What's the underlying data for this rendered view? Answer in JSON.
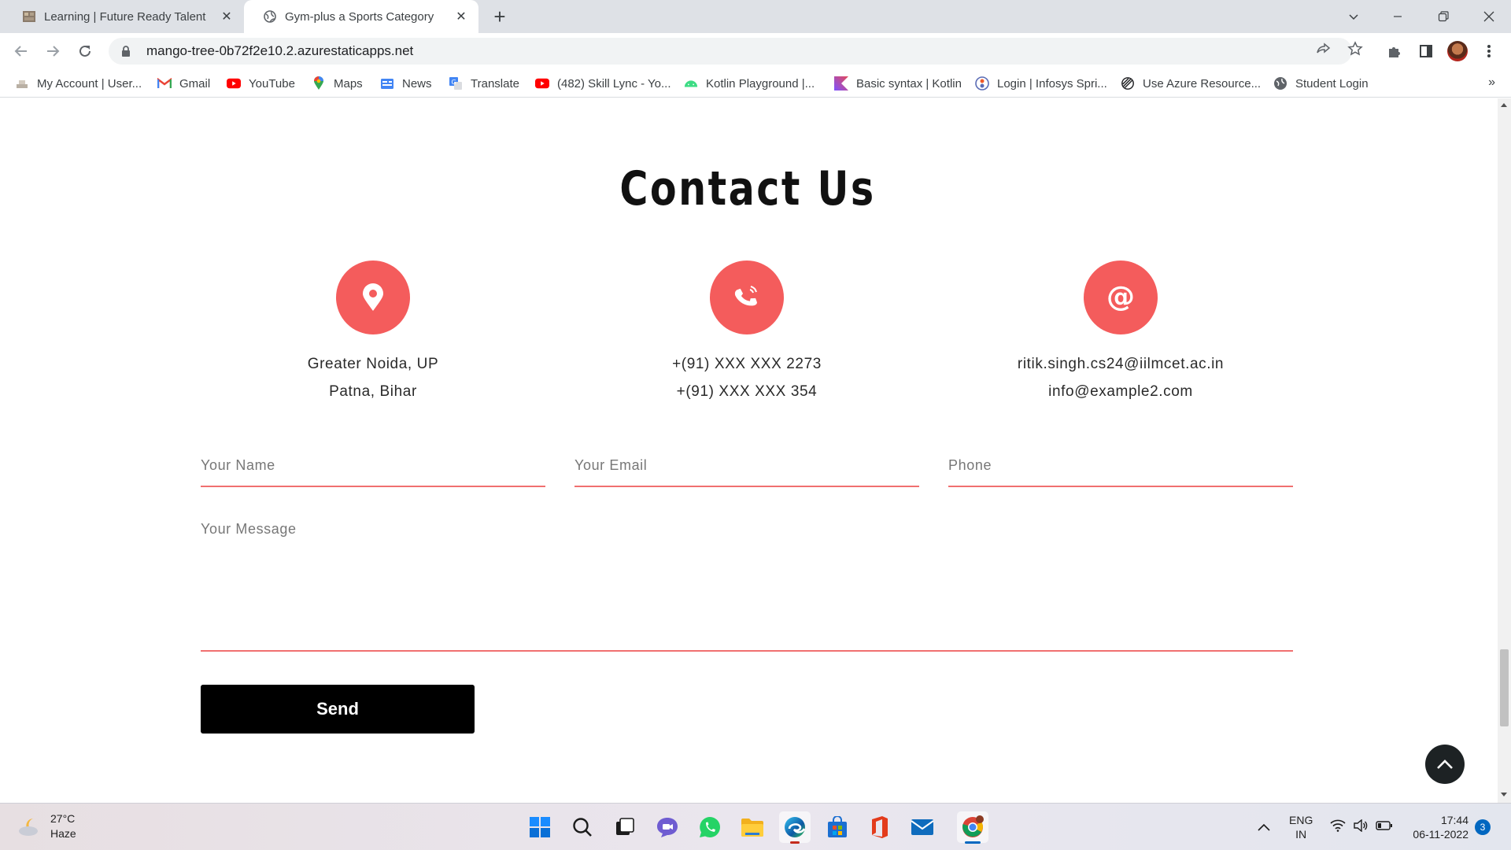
{
  "browser": {
    "tabs": [
      {
        "title": "Learning | Future Ready Talent",
        "active": false
      },
      {
        "title": "Gym-plus a Sports Category",
        "active": true
      }
    ],
    "url": "mango-tree-0b72f2e10.2.azurestaticapps.net",
    "bookmarks": [
      {
        "label": "My Account | User...",
        "icon": "account-icon"
      },
      {
        "label": "Gmail",
        "icon": "gmail-icon"
      },
      {
        "label": "YouTube",
        "icon": "youtube-icon"
      },
      {
        "label": "Maps",
        "icon": "maps-icon"
      },
      {
        "label": "News",
        "icon": "news-icon"
      },
      {
        "label": "Translate",
        "icon": "translate-icon"
      },
      {
        "label": "(482) Skill Lync - Yo...",
        "icon": "youtube-icon"
      },
      {
        "label": "Kotlin Playground |...",
        "icon": "android-icon"
      },
      {
        "label": "Basic syntax | Kotlin",
        "icon": "kotlin-icon"
      },
      {
        "label": "Login | Infosys Spri...",
        "icon": "infosys-icon"
      },
      {
        "label": "Use Azure Resource...",
        "icon": "azure-icon"
      },
      {
        "label": "Student Login",
        "icon": "globe-icon"
      }
    ]
  },
  "page": {
    "heading": "Contact Us",
    "contacts": [
      {
        "icon": "location-pin-icon",
        "lines": [
          "Greater Noida, UP",
          "Patna, Bihar"
        ]
      },
      {
        "icon": "phone-icon",
        "lines": [
          "+(91) XXX XXX 2273",
          "+(91) XXX XXX 354"
        ]
      },
      {
        "icon": "at-sign-icon",
        "lines": [
          "ritik.singh.cs24@iilmcet.ac.in",
          "info@example2.com"
        ]
      }
    ],
    "form": {
      "name_placeholder": "Your Name",
      "email_placeholder": "Your Email",
      "phone_placeholder": "Phone",
      "message_placeholder": "Your Message",
      "send_label": "Send"
    },
    "accent_color": "#f45c5c"
  },
  "taskbar": {
    "weather": {
      "temp": "27°C",
      "condition": "Haze"
    },
    "language": {
      "line1": "ENG",
      "line2": "IN"
    },
    "time": "17:44",
    "date": "06-11-2022",
    "notification_count": "3"
  }
}
